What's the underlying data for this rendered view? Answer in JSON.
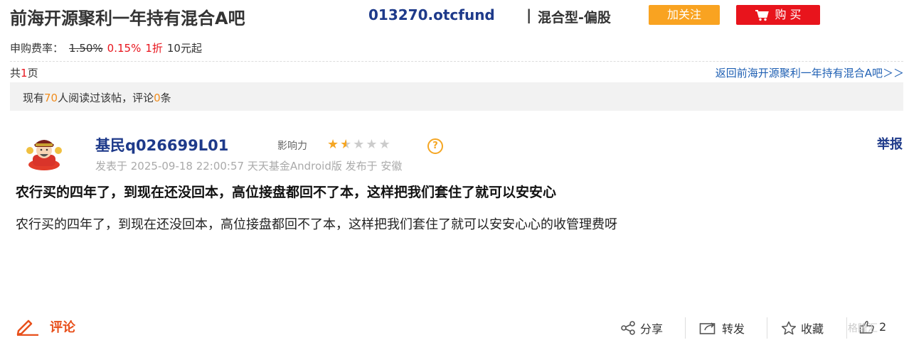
{
  "header": {
    "title": "前海开源聚利一年持有混合A吧",
    "code": "013270.otcfund",
    "separator": "|",
    "type": "混合型-偏股",
    "follow_label": "加关注",
    "buy_label": "购 买"
  },
  "fee": {
    "label": "申购费率：",
    "original": "1.50%",
    "discounted": "0.15%",
    "discount": "1折",
    "min_amount": "10元起"
  },
  "pagination": {
    "prefix": "共",
    "count": "1",
    "suffix": "页",
    "back_link": "返回前海开源聚利一年持有混合A吧＞＞"
  },
  "read_info": {
    "prefix": "现有",
    "readers": "70",
    "middle": "人阅读过该帖，评论",
    "comments": "0",
    "suffix": "条"
  },
  "post": {
    "username": "基民q026699L01",
    "influence_label": "影响力",
    "rating": 1.5,
    "rating_max": 5,
    "report_label": "举报",
    "meta": "发表于 2025-09-18 22:00:57 天天基金Android版 发布于 安徽",
    "title": "农行买的四年了，到现在还没回本，高位接盘都回不了本，这样把我们套住了就可以安安心",
    "body": "农行买的四年了，到现在还没回本，高位接盘都回不了本，这样把我们套住了就可以安安心心的收管理费呀"
  },
  "actions": {
    "comment_label": "评论",
    "share_label": "分享",
    "forward_label": "转发",
    "collect_label": "收藏",
    "like_count": "2"
  },
  "watermark": "格隆汇",
  "colors": {
    "accent_orange": "#f9a321",
    "buy_red": "#e8141c",
    "link_blue": "#1e3a8a",
    "star": "#f5a623"
  },
  "icons": [
    "cart-icon",
    "question-icon",
    "pencil-icon",
    "share-icon",
    "forward-icon",
    "star-outline-icon",
    "thumb-up-icon"
  ]
}
